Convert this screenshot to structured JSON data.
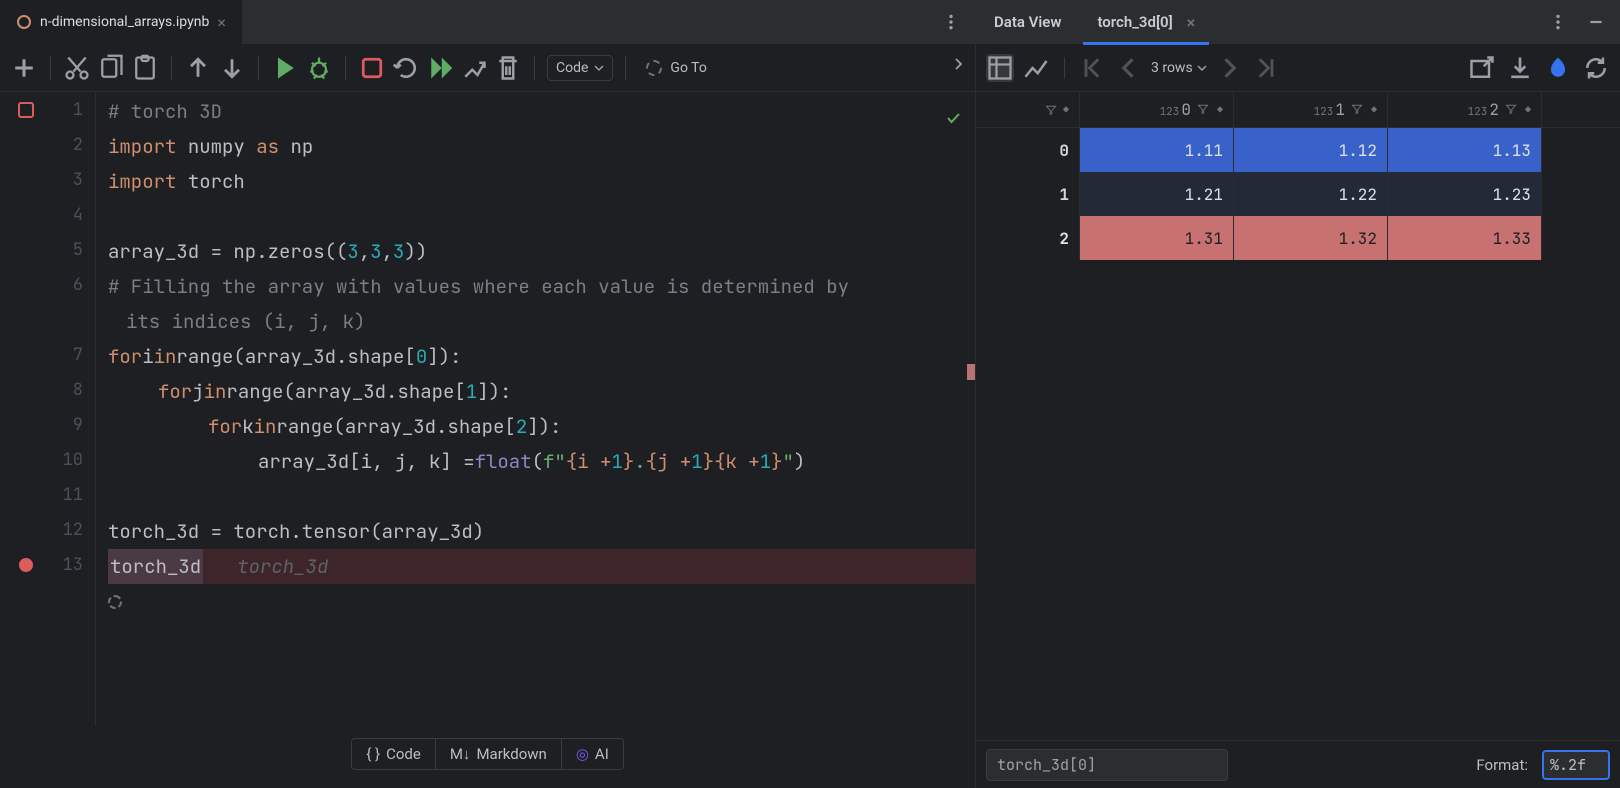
{
  "left_tab": {
    "filename": "n-dimensional_arrays.ipynb"
  },
  "toolbar": {
    "cell_type": "Code",
    "goto": "Go To"
  },
  "cell_buttons": {
    "code": "Code",
    "markdown": "Markdown",
    "ai": "AI"
  },
  "code": {
    "l1": "# torch 3D",
    "l2a": "import",
    "l2b": "numpy",
    "l2c": "as",
    "l2d": "np",
    "l3a": "import",
    "l3b": "torch",
    "l5a": "array_3d = np.zeros((",
    "l5b": "3",
    "l5c": ", ",
    "l5d": "3",
    "l5e": ", ",
    "l5f": "3",
    "l5g": "))",
    "l6": "# Filling the array with values where each value is determined by",
    "l6b": "its indices (i, j, k)",
    "l7a": "for",
    "l7b": " i ",
    "l7c": "in",
    "l7d": " range(array_3d.shape[",
    "l7e": "0",
    "l7f": "]):",
    "l8a": "for",
    "l8b": " j ",
    "l8c": "in",
    "l8d": " range(array_3d.shape[",
    "l8e": "1",
    "l8f": "]):",
    "l9a": "for",
    "l9b": " k ",
    "l9c": "in",
    "l9d": " range(array_3d.shape[",
    "l9e": "2",
    "l9f": "]):",
    "l10a": "array_3d[i, j, k] = ",
    "l10b": "float",
    "l10c": "(",
    "l10d": "f\"",
    "l10e": "{i + ",
    "l10f": "1",
    "l10g": "}",
    "l10h": ".",
    "l10i": "{j + ",
    "l10j": "1",
    "l10k": "}{k + ",
    "l10l": "1",
    "l10m": "}",
    "l10n": "\"",
    "l10o": ")",
    "l12": "torch_3d = torch.tensor(array_3d)",
    "l13a": "torch_3d",
    "l13hint": "torch_3d"
  },
  "gutter": {
    "ln1": "1",
    "ln2": "2",
    "ln3": "3",
    "ln4": "4",
    "ln5": "5",
    "ln6": "6",
    "ln7": "7",
    "ln8": "8",
    "ln9": "9",
    "ln10": "10",
    "ln11": "11",
    "ln12": "12",
    "ln13": "13"
  },
  "right": {
    "tabs": {
      "dataview": "Data View",
      "second": "torch_3d[0]"
    },
    "rows_label": "3 rows",
    "columns": [
      "0",
      "1",
      "2"
    ],
    "chart_data": {
      "type": "table",
      "index": [
        "0",
        "1",
        "2"
      ],
      "columns": [
        "0",
        "1",
        "2"
      ],
      "rows": [
        [
          "1.11",
          "1.12",
          "1.13"
        ],
        [
          "1.21",
          "1.22",
          "1.23"
        ],
        [
          "1.31",
          "1.32",
          "1.33"
        ]
      ]
    },
    "expression": "torch_3d[0]",
    "format_label": "Format:",
    "format_value": "%.2f"
  }
}
